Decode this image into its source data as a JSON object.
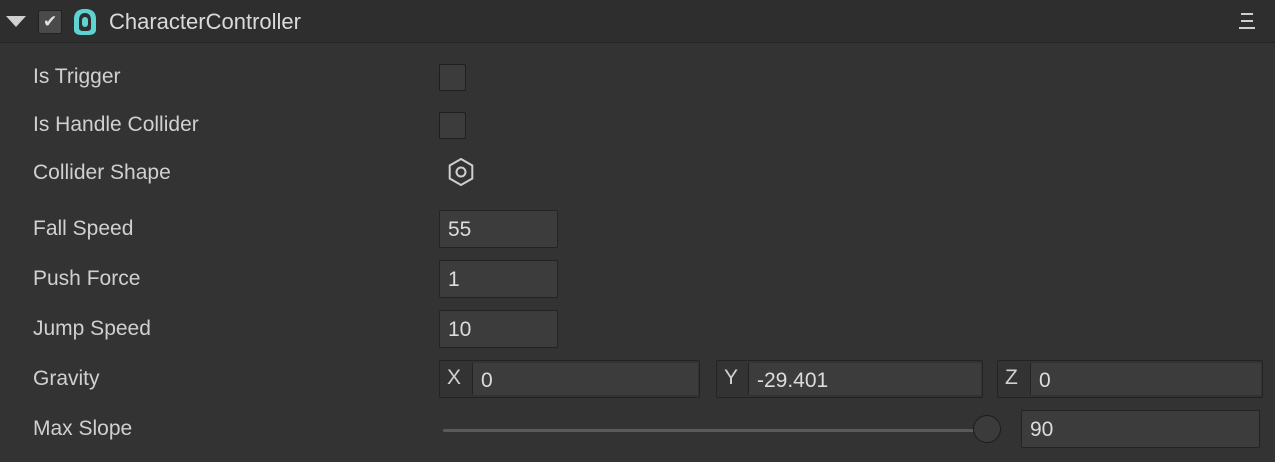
{
  "component": {
    "title": "CharacterController",
    "enabled": true,
    "check_glyph": "✔",
    "icon": "character-controller-icon",
    "menu_icon": "hamburger-menu-icon",
    "accent_color": "#5fd3d0"
  },
  "properties": {
    "is_trigger": {
      "label": "Is Trigger",
      "checked": false
    },
    "is_handle_collider": {
      "label": "Is Handle Collider",
      "checked": false
    },
    "collider_shape": {
      "label": "Collider Shape",
      "icon": "hexagon-nut-icon"
    },
    "fall_speed": {
      "label": "Fall Speed",
      "value": "55"
    },
    "push_force": {
      "label": "Push Force",
      "value": "1"
    },
    "jump_speed": {
      "label": "Jump Speed",
      "value": "10"
    },
    "gravity": {
      "label": "Gravity",
      "x_label": "X",
      "x": "0",
      "y_label": "Y",
      "y": "-29.401",
      "z_label": "Z",
      "z": "0"
    },
    "max_slope": {
      "label": "Max Slope",
      "value": "90",
      "slider_fraction": 1.0
    }
  }
}
